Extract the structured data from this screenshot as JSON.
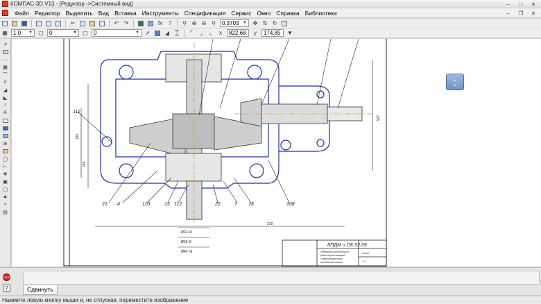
{
  "window": {
    "title": "КОМПАС-3D V13 - [Редуктор ->Системный вид]"
  },
  "menu": {
    "items": [
      "Файл",
      "Редактор",
      "Выделить",
      "Вид",
      "Вставка",
      "Инструменты",
      "Спецификация",
      "Сервис",
      "Окно",
      "Справка",
      "Библиотеки"
    ]
  },
  "toolbar": {
    "zoom_value": "0.3703",
    "line_scale": "1.0",
    "layer_value": "0",
    "style_value": "0",
    "coord_x": "822.68",
    "coord_y": "174.85"
  },
  "drawing": {
    "callouts": [
      "111",
      "21",
      "4",
      "110",
      "15",
      "112",
      "22",
      "7",
      "18",
      "108"
    ],
    "dims_left": [
      "185",
      "245"
    ],
    "dim_bottom": "210",
    "dim_right": "225",
    "dims_small_bottom": [
      "Ø32 k6",
      "Ø55 f6",
      "Ø40 h6"
    ],
    "title_block": {
      "designation": "КПДМ и ОК 02.09.",
      "name_lines": [
        "Редуктор конический",
        "одноступенчатый",
        "с вертикальным",
        "выходным валом"
      ],
      "sheet_info": "Лист",
      "scale": "1:1"
    }
  },
  "command_panel": {
    "tab_label": "Сдвинуть"
  },
  "status_bar": {
    "text": "Нажмите левую кнопку мыши и, не отпуская, переместите изображение"
  }
}
